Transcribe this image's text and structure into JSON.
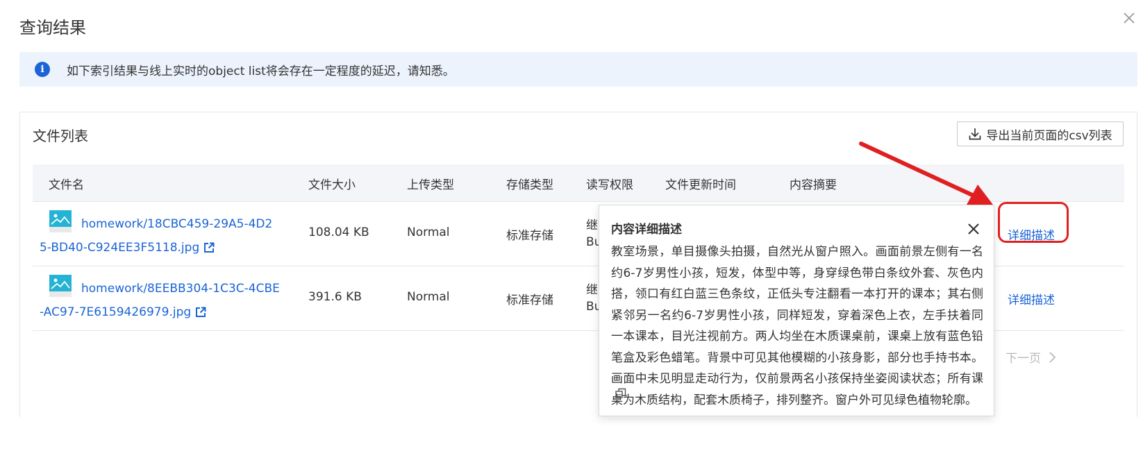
{
  "dialog": {
    "title": "查询结果",
    "close_icon": "close-icon"
  },
  "notice": {
    "icon": "info-icon",
    "text": "如下索引结果与线上实时的object list将会存在一定程度的延迟，请知悉。"
  },
  "file_list": {
    "title": "文件列表",
    "export_label": "导出当前页面的csv列表",
    "columns": [
      "文件名",
      "文件大小",
      "上传类型",
      "存储类型",
      "读写权限",
      "文件更新时间",
      "内容摘要"
    ],
    "rows": [
      {
        "name_line1": "homework/18CBC459-29A5-4D2",
        "name_line2": "5-BD40-C924EE3F5118.jpg",
        "size": "108.04 KB",
        "upload_type": "Normal",
        "storage_type": "标准存储",
        "acl_line1": "继",
        "acl_line2": "Bu",
        "action": "详细描述"
      },
      {
        "name_line1": "homework/8EEBB304-1C3C-4CBE",
        "name_line2": "-AC97-7E6159426979.jpg",
        "size": "391.6 KB",
        "upload_type": "Normal",
        "storage_type": "标准存储",
        "acl_line1": "继",
        "acl_line2": "Bu",
        "action": "详细描述"
      }
    ],
    "pager_next": "下一页"
  },
  "popover": {
    "title": "内容详细描述",
    "body": "教室场景，单目摄像头拍摄，自然光从窗户照入。画面前景左侧有一名约6-7岁男性小孩，短发，体型中等，身穿绿色带白条纹外套、灰色内搭，领口有红白蓝三色条纹，正低头专注翻看一本打开的课本；其右侧紧邻另一名约6-7岁男性小孩，同样短发，穿着深色上衣，左手扶着同一本课本，目光注视前方。两人均坐在木质课桌前，课桌上放有蓝色铅笔盒及彩色蜡笔。背景中可见其他模糊的小孩身影，部分也手持书本。画面中未见明显走动行为，仅前景两名小孩保持坐姿阅读状态；所有课桌为木质结构，配套木质椅子，排列整齐。窗户外可见绿色植物轮廓。"
  },
  "colors": {
    "link": "#1a64d6",
    "notice_bg": "#edf3fd",
    "annotation_red": "#e02020"
  }
}
